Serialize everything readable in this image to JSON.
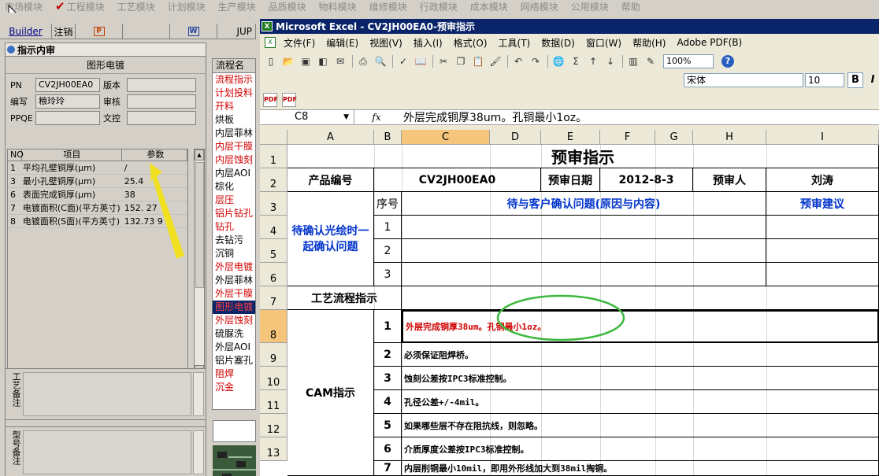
{
  "top_menu": [
    "市场模块",
    "工程模块",
    "工艺模块",
    "计划模块",
    "生产模块",
    "品质模块",
    "物料模块",
    "维修模块",
    "行政模块",
    "成本模块",
    "网络模块",
    "公用模块",
    "帮助"
  ],
  "left_toolbar": {
    "builder": "Builder",
    "logout": "注销",
    "jup": "JUP"
  },
  "review_panel": {
    "title": "指示内审",
    "subtitle": "图形电镀",
    "fields": [
      {
        "label": "PN",
        "value": "CV2JH00EA0",
        "label2": "版本"
      },
      {
        "label": "编写",
        "value": "粮玲玲",
        "label2": "审核"
      },
      {
        "label": "PPQE",
        "value": "",
        "label2": "文控"
      }
    ],
    "grid_headers": [
      "NO",
      "项目",
      "参数"
    ],
    "grid_rows": [
      {
        "no": "1",
        "item": "平均孔壁铜厚(μm)",
        "val": "/"
      },
      {
        "no": "3",
        "item": "最小孔壁铜厚(μm)",
        "val": "25.4"
      },
      {
        "no": "6",
        "item": "表面完成铜厚(μm)",
        "val": "38"
      },
      {
        "no": "7",
        "item": "电镀面积(C面)(平方英寸)",
        "val": "152.   27"
      },
      {
        "no": "8",
        "item": "电镀面积(S面)(平方英寸)",
        "val": "132.73   9"
      }
    ],
    "remark1": "工艺备注",
    "remark2": "型号备注"
  },
  "flow_list": {
    "header": "流程名",
    "items": [
      {
        "label": "流程指示",
        "style": "red"
      },
      {
        "label": "计划投料",
        "style": "red"
      },
      {
        "label": "开料",
        "style": "red"
      },
      {
        "label": "烘板",
        "style": "black"
      },
      {
        "label": "内层菲林",
        "style": "black"
      },
      {
        "label": "内层干膜",
        "style": "red"
      },
      {
        "label": "内层蚀刻",
        "style": "red"
      },
      {
        "label": "内层AOI",
        "style": "black"
      },
      {
        "label": "棕化",
        "style": "black"
      },
      {
        "label": "层压",
        "style": "red"
      },
      {
        "label": "铝片钻孔",
        "style": "red"
      },
      {
        "label": "钻孔",
        "style": "red"
      },
      {
        "label": "去钻污",
        "style": "black"
      },
      {
        "label": "沉铜",
        "style": "black"
      },
      {
        "label": "外层电镀",
        "style": "red"
      },
      {
        "label": "外层菲林",
        "style": "black"
      },
      {
        "label": "外层干膜",
        "style": "red"
      },
      {
        "label": "图形电镀",
        "style": "sel"
      },
      {
        "label": "外层蚀刻",
        "style": "red"
      },
      {
        "label": "硫脲洗",
        "style": "black"
      },
      {
        "label": "外层AOI",
        "style": "black"
      },
      {
        "label": "铝片塞孔",
        "style": "black"
      },
      {
        "label": "阻焊",
        "style": "red"
      },
      {
        "label": "沉金",
        "style": "red"
      }
    ]
  },
  "excel": {
    "title": "Microsoft Excel - CV2JH00EA0-预审指示",
    "menu": [
      "文件(F)",
      "编辑(E)",
      "视图(V)",
      "插入(I)",
      "格式(O)",
      "工具(T)",
      "数据(D)",
      "窗口(W)",
      "帮助(H)",
      "Adobe PDF(B)"
    ],
    "zoom": "100%",
    "font": "宋体",
    "font_size": "10",
    "bold": "B",
    "italic": "I",
    "name_box": "C8",
    "fx": "fx",
    "formula": "外层完成铜厚38um。孔铜最小1oz。",
    "columns": [
      "A",
      "B",
      "C",
      "D",
      "E",
      "F",
      "G",
      "H",
      "I"
    ],
    "rows": [
      "1",
      "2",
      "3",
      "4",
      "5",
      "6",
      "7",
      "8",
      "9",
      "10",
      "11",
      "12",
      "13"
    ],
    "sheet": {
      "title": "预审指示",
      "product_no_label": "产品编号",
      "product_no": "CV2JH00EA0",
      "date_label": "预审日期",
      "date": "2012-8-3",
      "reviewer_label": "预审人",
      "reviewer": "刘涛",
      "seq_label": "序号",
      "confirm_header": "待与客户确认问题(原因与内容)",
      "suggest_header": "预审建议",
      "pending_label": "待确认光绘时一起确认问题",
      "seq": [
        "1",
        "2",
        "3"
      ],
      "process_label": "工艺流程指示",
      "cam_label": "CAM指示",
      "cam_rows": [
        {
          "no": "1",
          "text": "外层完成铜厚38um。孔铜最小1oz。"
        },
        {
          "no": "2",
          "text": "必须保证阻焊桥。"
        },
        {
          "no": "3",
          "text": "蚀刻公差按IPC3标准控制。"
        },
        {
          "no": "4",
          "text": "孔径公差+/-4mil。"
        },
        {
          "no": "5",
          "text": "如果哪些层不存在阻抗线，则忽略。"
        },
        {
          "no": "6",
          "text": "介质厚度公差按IPC3标准控制。"
        },
        {
          "no": "7",
          "text": "内层削铜最小10mil，即用外形线加大到38mil掏铜。"
        }
      ]
    }
  },
  "colors": {
    "selection": "#0a246a",
    "red_text": "#d00000",
    "blue_text": "#0033cc",
    "highlight_ring": "#3cb83c",
    "arrow": "#f0e020"
  }
}
